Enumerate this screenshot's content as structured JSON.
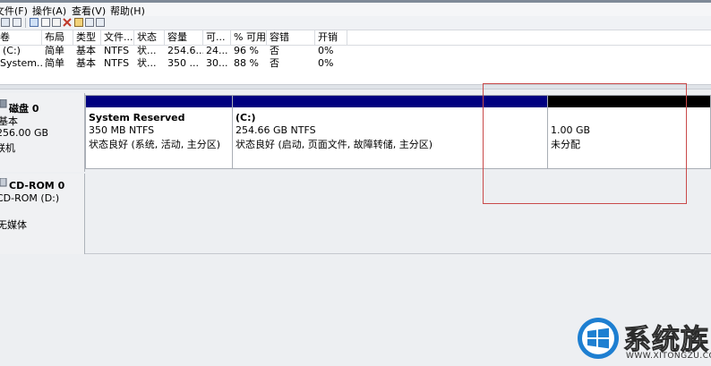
{
  "menu": {
    "items": [
      "文件(F)",
      "操作(A)",
      "查看(V)",
      "帮助(H)"
    ]
  },
  "volume_list": {
    "columns": [
      "卷",
      "布局",
      "类型",
      "文件...",
      "状态",
      "容量",
      "可...",
      "% 可用",
      "容错",
      "开销"
    ],
    "rows": [
      [
        "(C:)",
        "简单",
        "基本",
        "NTFS",
        "状...",
        "254.6...",
        "24...",
        "96 %",
        "否",
        "0%"
      ],
      [
        "System...",
        "简单",
        "基本",
        "NTFS",
        "状...",
        "350 ...",
        "30...",
        "88 %",
        "否",
        "0%"
      ]
    ]
  },
  "disks": [
    {
      "name": "磁盘 0",
      "type": "基本",
      "size": "256.00 GB",
      "status": "联机",
      "partitions": [
        {
          "title": "System Reserved",
          "size": "350 MB NTFS",
          "status": "状态良好 (系统, 活动, 主分区)",
          "bar_color": "#000080"
        },
        {
          "title": "(C:)",
          "size": "254.66 GB NTFS",
          "status": "状态良好 (启动, 页面文件, 故障转储, 主分区)",
          "bar_color": "#000080"
        },
        {
          "title": "",
          "size": "1.00 GB",
          "status": "未分配",
          "bar_color": "#000000"
        }
      ]
    },
    {
      "name": "CD-ROM 0",
      "type": "CD-ROM (D:)",
      "status": "无媒体"
    }
  ],
  "watermark": {
    "brand": "系统族",
    "url": "WWW.XITONGZU.COM"
  },
  "colors": {
    "primary_partition_bar": "#000080",
    "unallocated_bar": "#000000",
    "highlight_box": "#c94a4a"
  }
}
